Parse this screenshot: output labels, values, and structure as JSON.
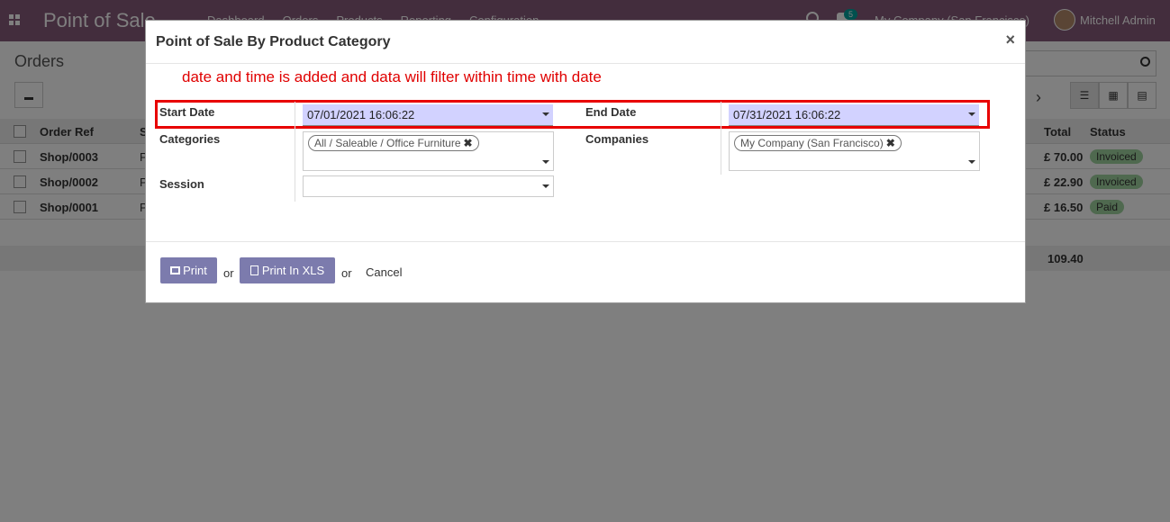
{
  "navbar": {
    "brand": "Point of Sale",
    "menu": [
      "Dashboard",
      "Orders",
      "Products",
      "Reporting",
      "Configuration"
    ],
    "chat_count": "5",
    "company": "My Company (San Francisco)",
    "user": "Mitchell Admin"
  },
  "control_panel": {
    "title": "Orders"
  },
  "list": {
    "headers": {
      "ref": "Order Ref",
      "s": "S",
      "total": "Total",
      "status": "Status"
    },
    "rows": [
      {
        "ref": "Shop/0003",
        "s": "P",
        "total": "£ 70.00",
        "status": "Invoiced"
      },
      {
        "ref": "Shop/0002",
        "s": "P",
        "total": "£ 22.90",
        "status": "Invoiced"
      },
      {
        "ref": "Shop/0001",
        "s": "P",
        "total": "£ 16.50",
        "status": "Paid"
      }
    ],
    "footer_total": "109.40"
  },
  "modal": {
    "title": "Point of Sale By Product Category",
    "close": "×",
    "annotation": "date and time is added and data will filter within time with date",
    "start_date_label": "Start Date",
    "start_date_value": "07/01/2021 16:06:22",
    "end_date_label": "End Date",
    "end_date_value": "07/31/2021 16:06:22",
    "categories_label": "Categories",
    "category_tag": "All / Saleable / Office Furniture",
    "companies_label": "Companies",
    "company_tag": "My Company (San Francisco)",
    "session_label": "Session",
    "print_label": "Print",
    "print_xls_label": "Print In XLS",
    "or_text": "or",
    "cancel_label": "Cancel"
  },
  "colors": {
    "navbar": "#875a7b",
    "primary_button": "#7c7bad",
    "date_field_bg": "#d2d2ff",
    "annotation": "#e00000",
    "badge": "#9fd39f"
  }
}
